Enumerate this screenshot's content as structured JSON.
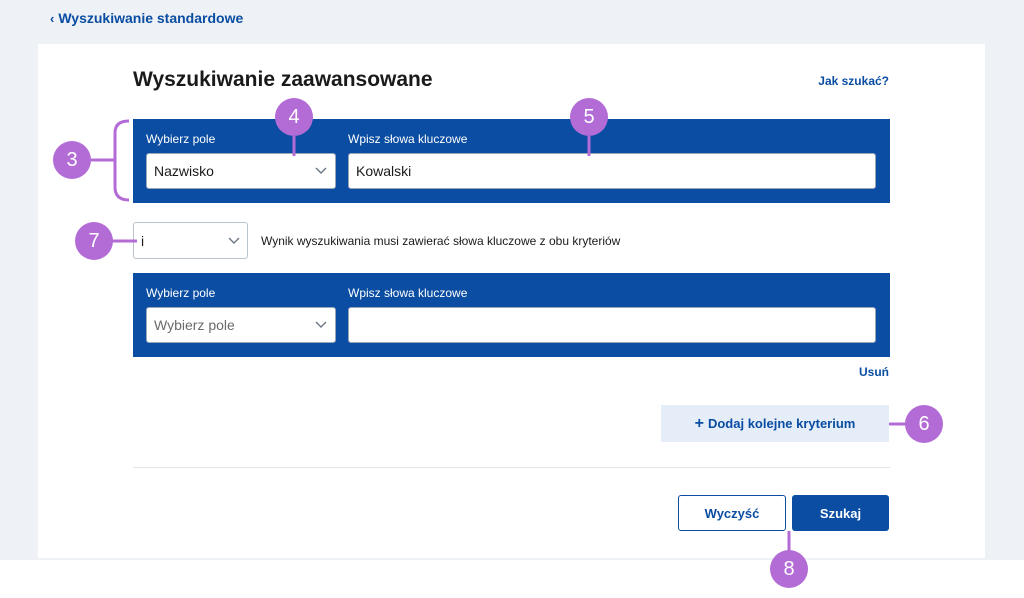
{
  "nav": {
    "back_label": "Wyszukiwanie standardowe"
  },
  "page": {
    "title": "Wyszukiwanie zaawansowane",
    "help_link": "Jak szukać?"
  },
  "criteria": [
    {
      "field_label": "Wybierz pole",
      "field_value": "Nazwisko",
      "keyword_label": "Wpisz słowa kluczowe",
      "keyword_value": "Kowalski"
    },
    {
      "field_label": "Wybierz pole",
      "field_placeholder": "Wybierz pole",
      "keyword_label": "Wpisz słowa kluczowe",
      "keyword_value": ""
    }
  ],
  "operator": {
    "value": "i",
    "description": "Wynik wyszukiwania musi zawierać słowa kluczowe z obu kryteriów"
  },
  "actions": {
    "remove_label": "Usuń",
    "add_label": "Dodaj kolejne kryterium",
    "clear_label": "Wyczyść",
    "search_label": "Szukaj"
  },
  "markers": [
    "3",
    "4",
    "5",
    "6",
    "7",
    "8"
  ],
  "colors": {
    "accent": "#0a4da2",
    "marker": "#b36bd6",
    "background": "#eef2f6"
  }
}
